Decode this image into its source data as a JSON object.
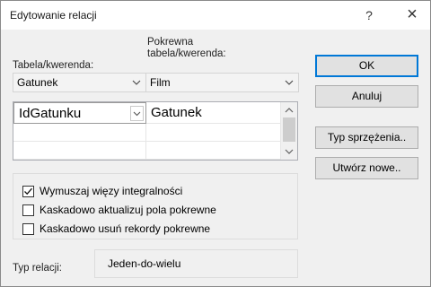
{
  "window": {
    "title": "Edytowanie relacji",
    "help_label": "?",
    "close_label": "×"
  },
  "table": {
    "label": "Tabela/kwerenda:",
    "value": "Gatunek"
  },
  "related": {
    "label_line1": "Pokrewna",
    "label_line2": "tabela/kwerenda:",
    "value": "Film"
  },
  "fields": {
    "rows": [
      {
        "left": "IdGatunku",
        "right": "Gatunek"
      },
      {
        "left": "",
        "right": ""
      },
      {
        "left": "",
        "right": ""
      }
    ]
  },
  "buttons": {
    "ok": "OK",
    "cancel": "Anuluj",
    "join_type": "Typ sprzężenia..",
    "create_new": "Utwórz nowe.."
  },
  "options": {
    "enforce": {
      "label": "Wymuszaj więzy integralności",
      "checked": true
    },
    "cascade_update": {
      "label": "Kaskadowo aktualizuj pola pokrewne",
      "checked": false
    },
    "cascade_delete": {
      "label": "Kaskadowo usuń rekordy pokrewne",
      "checked": false
    }
  },
  "relationship": {
    "label": "Typ relacji:",
    "value": "Jeden-do-wielu"
  },
  "colors": {
    "dialog_bg": "#f0f0f0",
    "default_button_border": "#0078d7"
  }
}
